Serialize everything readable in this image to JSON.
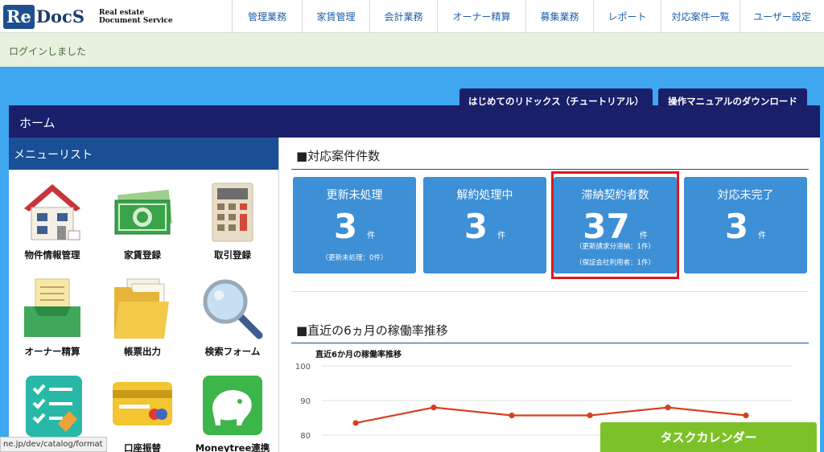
{
  "logo": {
    "re": "Re",
    "docs": "DocS",
    "subtitle": "Real estate\nDocument Service"
  },
  "nav": [
    "管理業務",
    "家賃管理",
    "会計業務",
    "オーナー精算",
    "募集業務",
    "レポート",
    "対応案件一覧",
    "ユーザー設定"
  ],
  "status_message": "ログインしました",
  "top_buttons": {
    "tutorial": "はじめてのリドックス（チュートリアル）",
    "manual": "操作マニュアルのダウンロード"
  },
  "home_title": "ホーム",
  "menu": {
    "title": "メニューリスト",
    "items": [
      {
        "label": "物件情報管理",
        "icon": "house-icon"
      },
      {
        "label": "家賃登録",
        "icon": "money-icon"
      },
      {
        "label": "取引登録",
        "icon": "calculator-icon"
      },
      {
        "label": "オーナー精算",
        "icon": "document-tray-icon"
      },
      {
        "label": "帳票出力",
        "icon": "folder-icon"
      },
      {
        "label": "検索フォーム",
        "icon": "magnifier-icon"
      },
      {
        "label": "",
        "icon": "checklist-icon"
      },
      {
        "label": "口座振替",
        "icon": "credit-card-icon"
      },
      {
        "label": "Moneytree連携",
        "icon": "elephant-icon"
      }
    ]
  },
  "cases": {
    "title": "■対応案件件数",
    "cards": [
      {
        "label": "更新未処理",
        "count": "3",
        "unit": "件",
        "notes": [
          "（更新未処理：0件）"
        ]
      },
      {
        "label": "解約処理中",
        "count": "3",
        "unit": "件",
        "notes": []
      },
      {
        "label": "滞納契約者数",
        "count": "37",
        "unit": "件",
        "notes": [
          "（更新請求分滞納：1件）",
          "（保証会社利用者：1件）"
        ]
      },
      {
        "label": "対応未完了",
        "count": "3",
        "unit": "件",
        "notes": []
      }
    ]
  },
  "occupancy": {
    "title": "■直近の6ヵ月の稼働率推移"
  },
  "chart_data": {
    "type": "line",
    "title": "直近6か月の稼働率推移",
    "x": [
      1,
      2,
      3,
      4,
      5,
      6
    ],
    "series": [
      {
        "values": [
          83.5,
          88,
          85.7,
          85.7,
          88,
          85.7
        ]
      }
    ],
    "yticks": [
      100,
      90,
      80
    ],
    "ylim": [
      77,
      100
    ],
    "grid": true,
    "color": "#d6401f"
  },
  "task_calendar": "タスクカレンダー",
  "url_tooltip": "ne.jp/dev/catalog/format"
}
